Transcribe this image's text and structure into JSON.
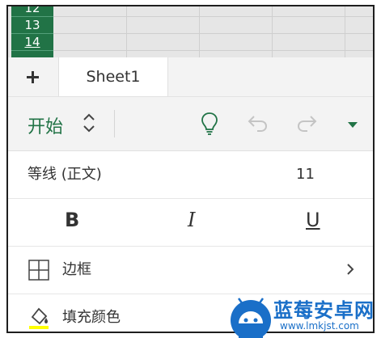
{
  "grid": {
    "rows": [
      "12",
      "13",
      "14"
    ],
    "selected_row": "14"
  },
  "tabbar": {
    "add_icon": "plus-icon",
    "sheet_tab_label": "Sheet1"
  },
  "ribbon": {
    "tab_title": "开始",
    "icons": [
      "chevron-up-down-icon",
      "lightbulb-icon",
      "undo-icon",
      "redo-icon",
      "dropdown-caret-icon"
    ]
  },
  "font": {
    "name": "等线 (正文)",
    "size": "11"
  },
  "format": {
    "bold": "B",
    "italic": "I",
    "underline": "U"
  },
  "menu": {
    "borders_label": "边框",
    "fill_label": "填充颜色"
  },
  "watermark": {
    "title": "蓝莓安卓网",
    "url": "www.lmkjst.com"
  },
  "colors": {
    "accent": "#217346",
    "fill_swatch": "#ffff00",
    "watermark": "#1a6fc8"
  }
}
